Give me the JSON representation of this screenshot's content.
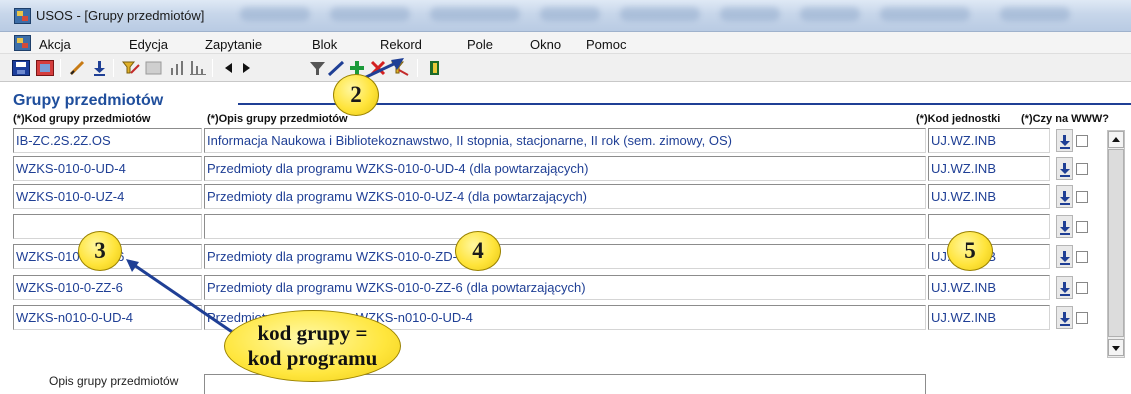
{
  "window": {
    "title": "USOS - [Grupy przedmiotów]"
  },
  "menu": [
    "Akcja",
    "Edycja",
    "Zapytanie",
    "Blok",
    "Rekord",
    "Pole",
    "Okno",
    "Pomoc"
  ],
  "toolbar_icons": [
    "save-icon",
    "exit-icon",
    "edit-icon",
    "download-icon",
    "query-icon",
    "query-disabled-icon",
    "chart-icon",
    "chart-bars-icon",
    "prev-icon",
    "next-icon",
    "filter-icon",
    "arrow-icon",
    "insert-record-icon",
    "delete-record-icon",
    "clear-icon",
    "book-icon"
  ],
  "section": {
    "title": "Grupy przedmiotów"
  },
  "columns": {
    "code": "(*)Kod grupy przedmiotów",
    "description": "(*)Opis grupy przedmiotów",
    "unit": "(*)Kod jednostki",
    "www": "(*)Czy na WWW?"
  },
  "rows": [
    {
      "code": "IB-ZC.2S.2Z.OS",
      "description": "Informacja Naukowa i Bibliotekoznawstwo, II stopnia, stacjonarne, II rok (sem. zimowy, OS)",
      "unit": "UJ.WZ.INB"
    },
    {
      "code": "WZKS-010-0-UD-4",
      "description": "Przedmioty dla programu WZKS-010-0-UD-4 (dla powtarzających)",
      "unit": "UJ.WZ.INB"
    },
    {
      "code": "WZKS-010-0-UZ-4",
      "description": "Przedmioty dla programu WZKS-010-0-UZ-4 (dla powtarzających)",
      "unit": "UJ.WZ.INB"
    },
    {
      "code": "",
      "description": "",
      "unit": ""
    },
    {
      "code": "WZKS-010-0-ZD-6",
      "description": "Przedmioty dla programu WZKS-010-0-ZD-6",
      "unit": "UJ.WZ.INB"
    },
    {
      "code": "WZKS-010-0-ZZ-6",
      "description": "Przedmioty dla programu WZKS-010-0-ZZ-6 (dla powtarzających)",
      "unit": "UJ.WZ.INB"
    },
    {
      "code": "WZKS-n010-0-UD-4",
      "description": "Przedmioty dla programu WZKS-n010-0-UD-4",
      "unit": "UJ.WZ.INB"
    }
  ],
  "detail": {
    "label": "Opis grupy przedmiotów",
    "value": ""
  },
  "annotations": {
    "badge_toolbar": "2",
    "badge_code": "3",
    "badge_description": "4",
    "badge_unit": "5",
    "callout_line1": "kod  grupy =",
    "callout_line2": "kod programu"
  },
  "colors": {
    "text_blue": "#1f3f95",
    "annotation_yellow": "#ffe43a"
  }
}
